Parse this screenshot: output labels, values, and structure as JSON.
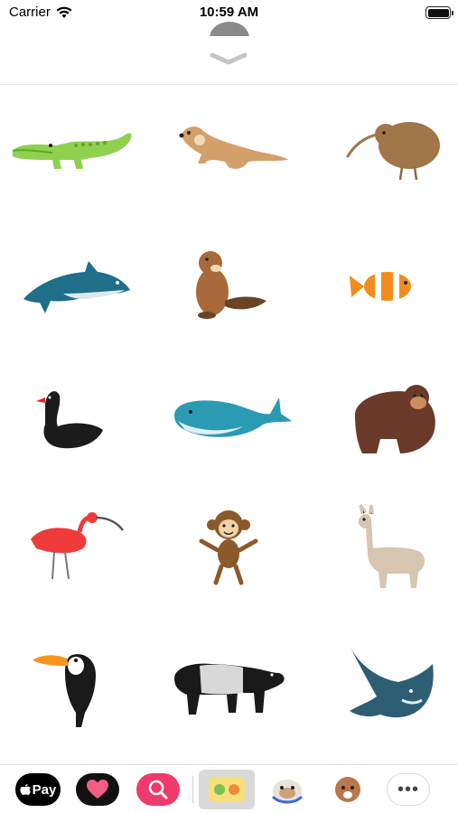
{
  "status_bar": {
    "carrier": "Carrier",
    "time": "10:59 AM"
  },
  "sheet": {
    "handle_icon": "chevron-down-icon"
  },
  "stickers": [
    {
      "name": "crocodile"
    },
    {
      "name": "otter"
    },
    {
      "name": "kiwi"
    },
    {
      "name": "dolphin"
    },
    {
      "name": "beaver"
    },
    {
      "name": "clownfish"
    },
    {
      "name": "black-swan"
    },
    {
      "name": "whale"
    },
    {
      "name": "gorilla"
    },
    {
      "name": "scarlet-ibis"
    },
    {
      "name": "monkey"
    },
    {
      "name": "llama"
    },
    {
      "name": "toucan"
    },
    {
      "name": "tapir"
    },
    {
      "name": "manta-ray"
    }
  ],
  "app_drawer": {
    "apple_pay_label": "Pay",
    "items": [
      "apple-pay",
      "heart-app",
      "search-app",
      "sticker-pack",
      "bulldog-stickers",
      "poodle-stickers",
      "more"
    ],
    "more_label": "•••"
  }
}
